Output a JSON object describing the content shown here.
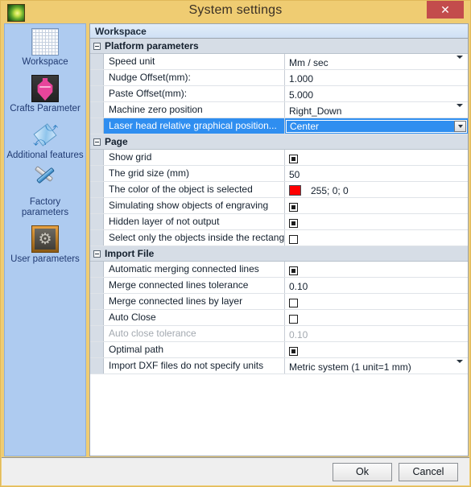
{
  "window": {
    "title": "System settings",
    "app_icon": "laser-app-icon",
    "close_label": "✕"
  },
  "sidebar": {
    "items": [
      {
        "label": "Workspace",
        "icon": "grid-canvas-icon",
        "selected": true
      },
      {
        "label": "Crafts Parameter",
        "icon": "vase-icon",
        "selected": false
      },
      {
        "label": "Additional features",
        "icon": "rotate-arrows-icon",
        "selected": false
      },
      {
        "label": "Factory parameters",
        "icon": "hammer-wrench-icon",
        "selected": false
      },
      {
        "label": "User parameters",
        "icon": "gear-icon",
        "selected": false
      }
    ]
  },
  "panel": {
    "header": "Workspace",
    "groups": [
      {
        "name": "Platform parameters",
        "expander": "collapse-icon",
        "rows": [
          {
            "name": "Speed unit",
            "value": "Mm / sec",
            "type": "dropdown",
            "disabled": false,
            "selected": false
          },
          {
            "name": "Nudge Offset(mm):",
            "value": "1.000",
            "type": "text",
            "disabled": false,
            "selected": false
          },
          {
            "name": "Paste Offset(mm):",
            "value": "5.000",
            "type": "text",
            "disabled": false,
            "selected": false
          },
          {
            "name": "Machine zero position",
            "value": "Right_Down",
            "type": "dropdown",
            "disabled": false,
            "selected": false
          },
          {
            "name": "Laser head relative graphical position...",
            "value": "Center",
            "type": "editing-dropdown",
            "disabled": false,
            "selected": true
          }
        ]
      },
      {
        "name": "Page",
        "expander": "collapse-icon",
        "rows": [
          {
            "name": "Show grid",
            "value": "",
            "type": "checkbox",
            "checked": true,
            "disabled": false,
            "selected": false
          },
          {
            "name": "The grid size (mm)",
            "value": "50",
            "type": "text",
            "disabled": false,
            "selected": false
          },
          {
            "name": "The color of the object is selected",
            "value": "255; 0; 0",
            "type": "color",
            "color": "#ff0000",
            "disabled": false,
            "selected": false
          },
          {
            "name": "Simulating show objects of engraving",
            "value": "",
            "type": "checkbox",
            "checked": true,
            "disabled": false,
            "selected": false
          },
          {
            "name": "Hidden layer of not output",
            "value": "",
            "type": "checkbox",
            "checked": true,
            "disabled": false,
            "selected": false
          },
          {
            "name": "Select only the objects inside the rectangl",
            "value": "",
            "type": "checkbox",
            "checked": false,
            "disabled": false,
            "selected": false
          }
        ]
      },
      {
        "name": "Import File",
        "expander": "collapse-icon",
        "rows": [
          {
            "name": "Automatic merging connected lines",
            "value": "",
            "type": "checkbox",
            "checked": true,
            "disabled": false,
            "selected": false
          },
          {
            "name": "Merge connected lines tolerance",
            "value": "0.10",
            "type": "text",
            "disabled": false,
            "selected": false
          },
          {
            "name": "Merge connected lines by layer",
            "value": "",
            "type": "checkbox",
            "checked": false,
            "disabled": false,
            "selected": false
          },
          {
            "name": "Auto Close",
            "value": "",
            "type": "checkbox",
            "checked": false,
            "disabled": false,
            "selected": false
          },
          {
            "name": "Auto close tolerance",
            "value": "0.10",
            "type": "text",
            "disabled": true,
            "selected": false
          },
          {
            "name": "Optimal path",
            "value": "",
            "type": "checkbox",
            "checked": true,
            "disabled": false,
            "selected": false
          },
          {
            "name": "Import DXF files do not specify units",
            "value": "Metric system (1 unit=1 mm)",
            "type": "dropdown",
            "disabled": false,
            "selected": false
          }
        ]
      }
    ]
  },
  "footer": {
    "ok_label": "Ok",
    "cancel_label": "Cancel"
  },
  "colors": {
    "titlebar": "#efcc72",
    "close_button": "#c34c4c",
    "sidebar": "#aecbf0",
    "selection": "#2f8ef0",
    "group_header": "#d6dde6",
    "selected_object_color": "#ff0000"
  }
}
